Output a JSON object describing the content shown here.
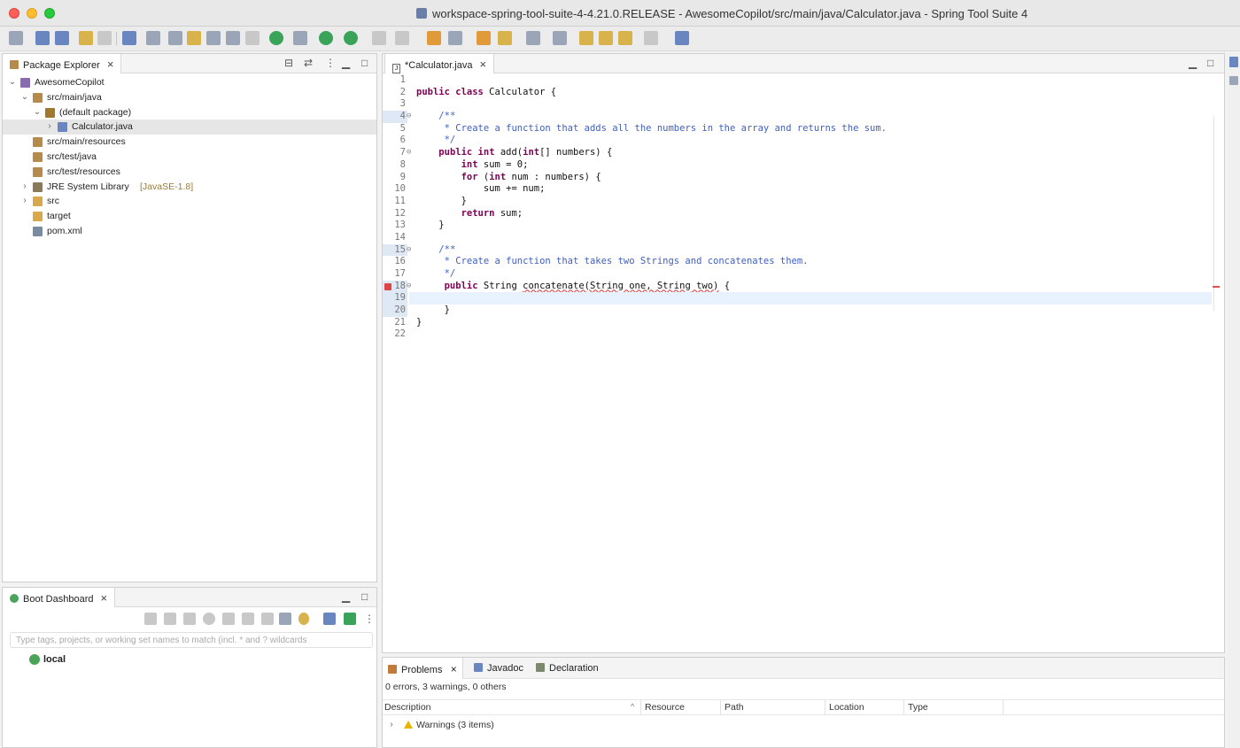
{
  "window": {
    "title": "workspace-spring-tool-suite-4-4.21.0.RELEASE - AwesomeCopilot/src/main/java/Calculator.java - Spring Tool Suite 4"
  },
  "package_explorer": {
    "tab_label": "Package Explorer",
    "tree": [
      {
        "label": "AwesomeCopilot",
        "depth": 0,
        "twisty": "v",
        "icon": "project-icon"
      },
      {
        "label": "src/main/java",
        "depth": 1,
        "twisty": "v",
        "icon": "source-folder-icon"
      },
      {
        "label": "(default package)",
        "depth": 2,
        "twisty": "v",
        "icon": "package-icon"
      },
      {
        "label": "Calculator.java",
        "depth": 3,
        "twisty": ">",
        "icon": "java-file-icon",
        "selected": true
      },
      {
        "label": "src/main/resources",
        "depth": 1,
        "twisty": "",
        "icon": "source-folder-icon"
      },
      {
        "label": "src/test/java",
        "depth": 1,
        "twisty": "",
        "icon": "source-folder-icon"
      },
      {
        "label": "src/test/resources",
        "depth": 1,
        "twisty": "",
        "icon": "source-folder-icon"
      },
      {
        "label": "JRE System Library",
        "decoration": "[JavaSE-1.8]",
        "depth": 1,
        "twisty": ">",
        "icon": "library-icon"
      },
      {
        "label": "src",
        "depth": 1,
        "twisty": ">",
        "icon": "folder-icon"
      },
      {
        "label": "target",
        "depth": 1,
        "twisty": "",
        "icon": "folder-icon"
      },
      {
        "label": "pom.xml",
        "depth": 1,
        "twisty": "",
        "icon": "xml-file-icon"
      }
    ]
  },
  "boot_dashboard": {
    "tab_label": "Boot Dashboard",
    "filter_placeholder": "Type tags, projects, or working set names to match (incl. * and ? wildcards",
    "local_label": "local"
  },
  "editor": {
    "tab_label": "*Calculator.java",
    "lines": [
      {
        "n": "1",
        "html": ""
      },
      {
        "n": "2",
        "html": "<span class='kw'>public class</span> Calculator {"
      },
      {
        "n": "3",
        "html": ""
      },
      {
        "n": "4",
        "fold": true,
        "html": "    <span class='cm'>/**</span>"
      },
      {
        "n": "5",
        "html": "<span class='cm'>     * Create a function that adds all the numbers in the array and returns the sum.</span>"
      },
      {
        "n": "6",
        "html": "<span class='cm'>     */</span>"
      },
      {
        "n": "7",
        "fold": true,
        "html": "    <span class='kw'>public int</span> add(<span class='kw'>int</span>[] numbers) {"
      },
      {
        "n": "8",
        "html": "        <span class='kw'>int</span> sum = 0;"
      },
      {
        "n": "9",
        "html": "        <span class='kw'>for</span> (<span class='kw'>int</span> num : numbers) {"
      },
      {
        "n": "10",
        "html": "            sum += num;"
      },
      {
        "n": "11",
        "html": "        }"
      },
      {
        "n": "12",
        "html": "        <span class='kw'>return</span> sum;"
      },
      {
        "n": "13",
        "html": "    }"
      },
      {
        "n": "14",
        "html": ""
      },
      {
        "n": "15",
        "fold": true,
        "html": "    <span class='cm'>/**</span>"
      },
      {
        "n": "16",
        "html": "<span class='cm'>     * Create a function that takes two Strings and concatenates them.</span>"
      },
      {
        "n": "17",
        "html": "<span class='cm'>     */</span>"
      },
      {
        "n": "18",
        "fold": true,
        "error": true,
        "html": "     <span class='kw'>public</span> String <span class='err'>concatenate(String one, String two)</span> {"
      },
      {
        "n": "19",
        "current": true,
        "html": ""
      },
      {
        "n": "20",
        "html": "     }"
      },
      {
        "n": "21",
        "html": "}"
      },
      {
        "n": "22",
        "html": ""
      }
    ]
  },
  "problems": {
    "tabs": [
      {
        "label": "Problems",
        "active": true,
        "icon": "problems-icon"
      },
      {
        "label": "Javadoc",
        "icon": "javadoc-icon"
      },
      {
        "label": "Declaration",
        "icon": "declaration-icon"
      }
    ],
    "summary": "0 errors, 3 warnings, 0 others",
    "columns": [
      "Description",
      "Resource",
      "Path",
      "Location",
      "Type"
    ],
    "rows": [
      {
        "label": "Warnings (3 items)"
      }
    ]
  }
}
